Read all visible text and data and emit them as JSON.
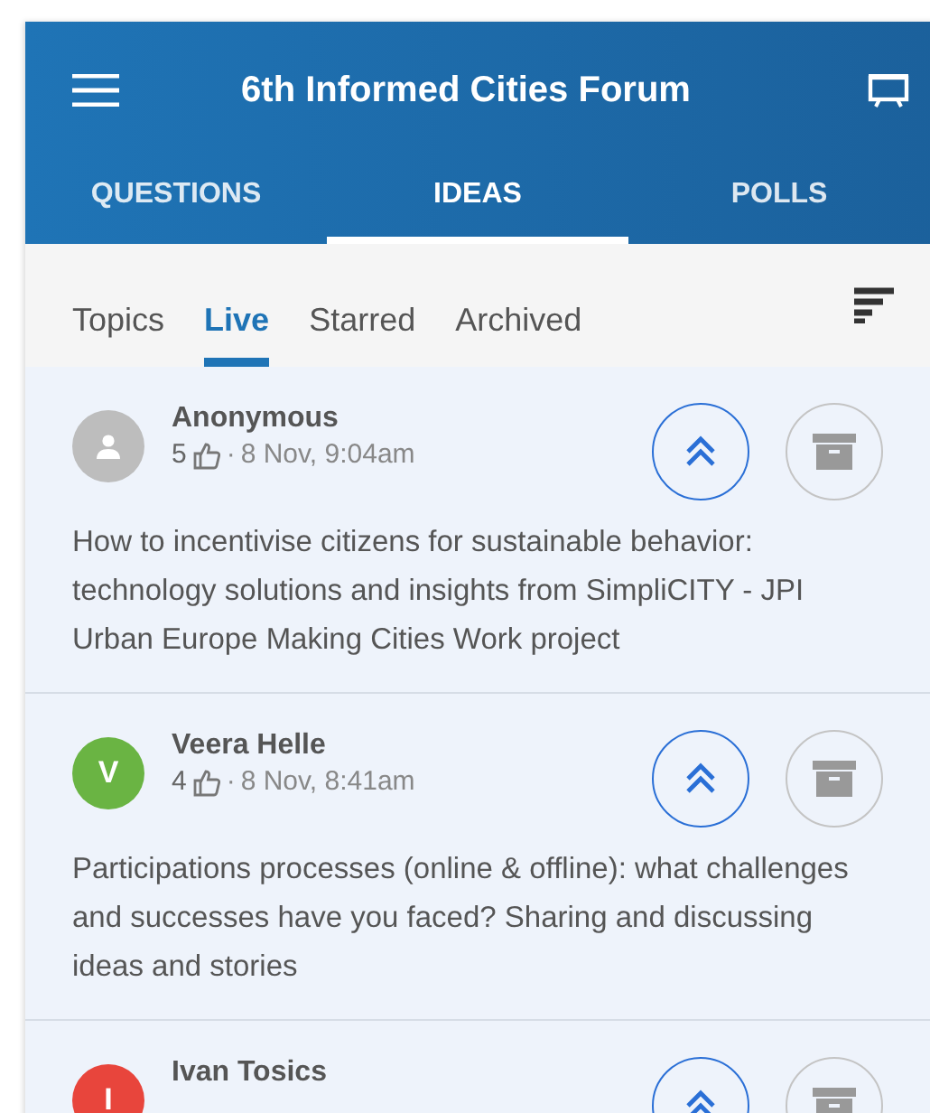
{
  "header": {
    "title": "6th Informed Cities Forum"
  },
  "tabs": [
    {
      "label": "QUESTIONS",
      "selected": false
    },
    {
      "label": "IDEAS",
      "selected": true
    },
    {
      "label": "POLLS",
      "selected": false
    }
  ],
  "subtabs": [
    {
      "label": "Topics",
      "selected": false
    },
    {
      "label": "Live",
      "selected": true
    },
    {
      "label": "Starred",
      "selected": false
    },
    {
      "label": "Archived",
      "selected": false
    }
  ],
  "ideas": [
    {
      "author": "Anonymous",
      "avatar": {
        "kind": "anonymous"
      },
      "likes": "5",
      "separator": "·",
      "time": "8 Nov, 9:04am",
      "text": "How to incentivise citizens for sustainable behavior: technology solutions and insights from SimpliCITY - JPI Urban Europe Making Cities Work project"
    },
    {
      "author": "Veera Helle",
      "avatar": {
        "kind": "initial",
        "initial": "V",
        "color": "#6ab443"
      },
      "likes": "4",
      "separator": "·",
      "time": "8 Nov, 8:41am",
      "text": "Participations processes (online & offline): what challenges and successes have you faced? Sharing and discussing ideas and stories"
    },
    {
      "author": "Ivan Tosics",
      "avatar": {
        "kind": "initial",
        "initial": "I",
        "color": "#e8453c"
      }
    }
  ]
}
